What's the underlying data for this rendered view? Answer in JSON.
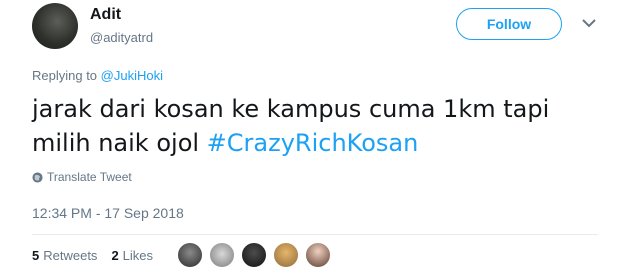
{
  "user": {
    "display_name": "Adit",
    "handle": "@adityatrd"
  },
  "follow_label": "Follow",
  "reply": {
    "prefix": "Replying to ",
    "mention": "@JukiHoki"
  },
  "tweet": {
    "text": "jarak dari kosan ke kampus cuma 1km tapi milih naik ojol ",
    "hashtag": "#CrazyRichKosan"
  },
  "translate_label": "Translate Tweet",
  "timestamp": "12:34 PM - 17 Sep 2018",
  "stats": {
    "retweets_count": "5",
    "retweets_label": "Retweets",
    "likes_count": "2",
    "likes_label": "Likes"
  },
  "colors": {
    "accent": "#1da1f2",
    "muted": "#657786",
    "text": "#14171a"
  }
}
